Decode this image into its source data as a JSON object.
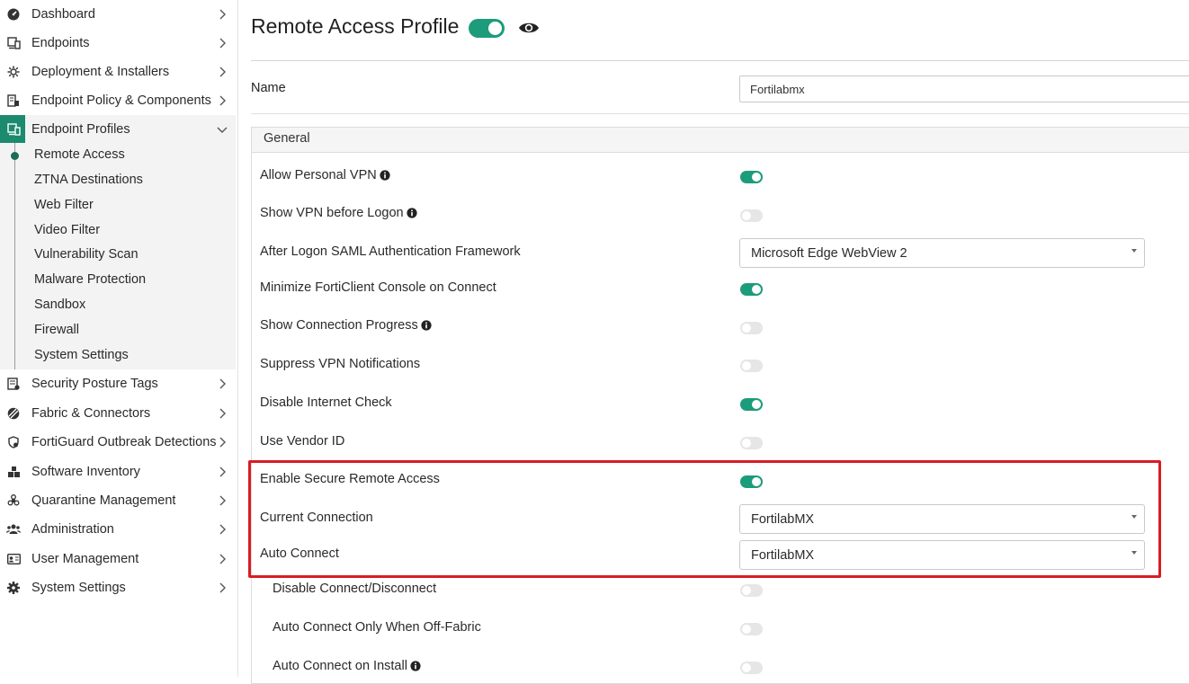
{
  "sidebar": {
    "items": [
      {
        "label": "Dashboard",
        "icon": "dashboard-icon"
      },
      {
        "label": "Endpoints",
        "icon": "endpoints-icon"
      },
      {
        "label": "Deployment & Installers",
        "icon": "deployment-icon"
      },
      {
        "label": "Endpoint Policy & Components",
        "icon": "policy-icon"
      },
      {
        "label": "Endpoint Profiles",
        "icon": "profiles-icon"
      },
      {
        "label": "Security Posture Tags",
        "icon": "tags-icon"
      },
      {
        "label": "Fabric & Connectors",
        "icon": "fabric-icon"
      },
      {
        "label": "FortiGuard Outbreak Detections",
        "icon": "outbreak-icon"
      },
      {
        "label": "Software Inventory",
        "icon": "inventory-icon"
      },
      {
        "label": "Quarantine Management",
        "icon": "quarantine-icon"
      },
      {
        "label": "Administration",
        "icon": "administration-icon"
      },
      {
        "label": "User Management",
        "icon": "user-management-icon"
      },
      {
        "label": "System Settings",
        "icon": "gear-icon"
      }
    ],
    "profiles_sub": [
      "Remote Access",
      "ZTNA Destinations",
      "Web Filter",
      "Video Filter",
      "Vulnerability Scan",
      "Malware Protection",
      "Sandbox",
      "Firewall",
      "System Settings"
    ],
    "active_sub": "Remote Access"
  },
  "header": {
    "title": "Remote Access Profile",
    "enabled": true
  },
  "name_field": {
    "label": "Name",
    "value": "Fortilabmx"
  },
  "general": {
    "title": "General",
    "rows": [
      {
        "label": "Allow Personal VPN",
        "info": true,
        "type": "toggle",
        "on": true
      },
      {
        "label": "Show VPN before Logon",
        "info": true,
        "type": "toggle",
        "on": false
      },
      {
        "label": "After Logon SAML Authentication Framework",
        "info": false,
        "type": "select",
        "value": "Microsoft Edge WebView 2"
      },
      {
        "label": "Minimize FortiClient Console on Connect",
        "info": false,
        "type": "toggle",
        "on": true
      },
      {
        "label": "Show Connection Progress",
        "info": true,
        "type": "toggle",
        "on": false
      },
      {
        "label": "Suppress VPN Notifications",
        "info": false,
        "type": "toggle",
        "on": false
      },
      {
        "label": "Disable Internet Check",
        "info": false,
        "type": "toggle",
        "on": true
      },
      {
        "label": "Use Vendor ID",
        "info": false,
        "type": "toggle",
        "on": false
      },
      {
        "label": "Enable Secure Remote Access",
        "info": false,
        "type": "toggle",
        "on": true
      },
      {
        "label": "Current Connection",
        "info": false,
        "type": "select",
        "value": "FortilabMX"
      },
      {
        "label": "Auto Connect",
        "info": false,
        "type": "select",
        "value": "FortilabMX"
      },
      {
        "label": "Disable Connect/Disconnect",
        "info": false,
        "type": "toggle",
        "on": false
      },
      {
        "label": "Auto Connect Only When Off-Fabric",
        "info": false,
        "type": "toggle",
        "on": false
      },
      {
        "label": "Auto Connect on Install",
        "info": true,
        "type": "toggle",
        "on": false
      }
    ]
  },
  "colors": {
    "accent": "#1c9c7b",
    "active_nav": "#1c8a6e",
    "highlight": "#d91c24"
  }
}
